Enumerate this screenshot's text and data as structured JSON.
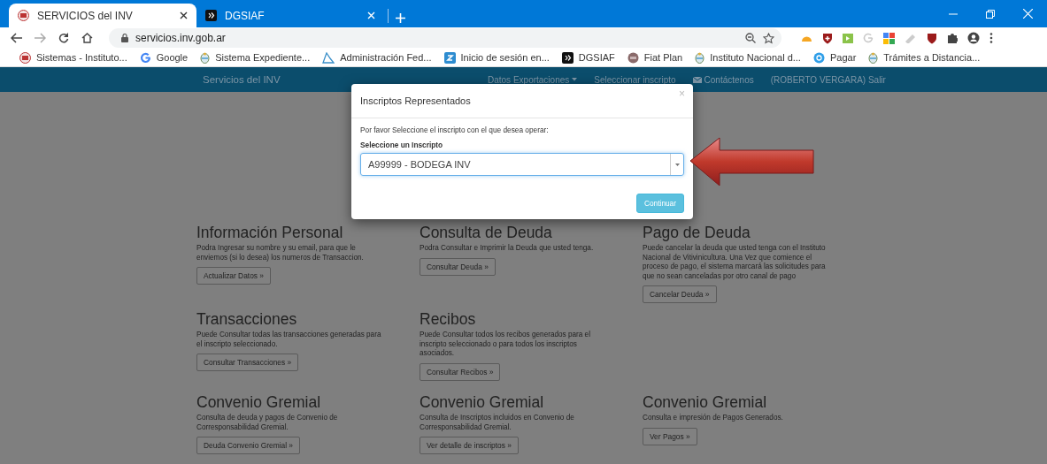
{
  "browser": {
    "tabs": [
      {
        "title": "SERVICIOS del INV",
        "selected": true
      },
      {
        "title": "DGSIAF",
        "selected": false
      }
    ],
    "address": "servicios.inv.gob.ar",
    "bookmarks": [
      "Sistemas - Instituto...",
      "Google",
      "Sistema Expediente...",
      "Administración Fed...",
      "Inicio de sesión en...",
      "DGSIAF",
      "Fiat Plan",
      "Instituto Nacional d...",
      "Pagar",
      "Trámites a Distancia..."
    ]
  },
  "navbar": {
    "brand": "Servicios del INV",
    "items": [
      {
        "label": "Datos Exportaciones",
        "kind": "dropdown"
      },
      {
        "label": "Seleccionar inscripto",
        "kind": "link"
      },
      {
        "label": "Contáctenos",
        "kind": "mail"
      },
      {
        "label": "(ROBERTO VERGARA) Salir",
        "kind": "link"
      }
    ]
  },
  "cards": [
    {
      "title": "Información Personal",
      "text": "Podra Ingresar su nombre y su email, para que le enviemos (si lo desea) los numeros de Transaccion.",
      "button": "Actualizar Datos »"
    },
    {
      "title": "Consulta de Deuda",
      "text": "Podra Consultar e Imprimir la Deuda que usted tenga.",
      "button": "Consultar Deuda »"
    },
    {
      "title": "Pago de Deuda",
      "text": "Puede cancelar la deuda que usted tenga con el Instituto Nacional de Vitivinicultura. Una Vez que comience el proceso de pago, el sistema marcará las solicitudes para que no sean canceladas por otro canal de pago",
      "button": "Cancelar Deuda »"
    },
    {
      "title": "Transacciones",
      "text": "Puede Consultar todas las transacciones generadas para el inscripto seleccionado.",
      "button": "Consultar Transacciones »"
    },
    {
      "title": "Recibos",
      "text": "Puede Consultar todos los recibos generados para el inscripto seleccionado o para todos los inscriptos asociados.",
      "button": "Consultar Recibos »"
    },
    {
      "title": "Convenio Gremial",
      "text": "Consulta de deuda y pagos de Convenio de Corresponsabilidad Gremial.",
      "button": "Deuda Convenio Gremial »"
    },
    {
      "title": "Convenio Gremial",
      "text": "Consulta de Inscriptos incluidos en Convenio de Corresponsabilidad Gremial.",
      "button": "Ver detalle de inscriptos »"
    },
    {
      "title": "Convenio Gremial",
      "text": "Consulta e impresión de Pagos Generados.",
      "button": "Ver Pagos »"
    }
  ],
  "modal": {
    "title": "Inscriptos Representados",
    "close": "×",
    "prompt": "Por favor Seleccione el inscripto con el que desea operar:",
    "label": "Seleccione un Inscripto",
    "value": "A99999 - BODEGA INV",
    "button": "Continuar"
  }
}
